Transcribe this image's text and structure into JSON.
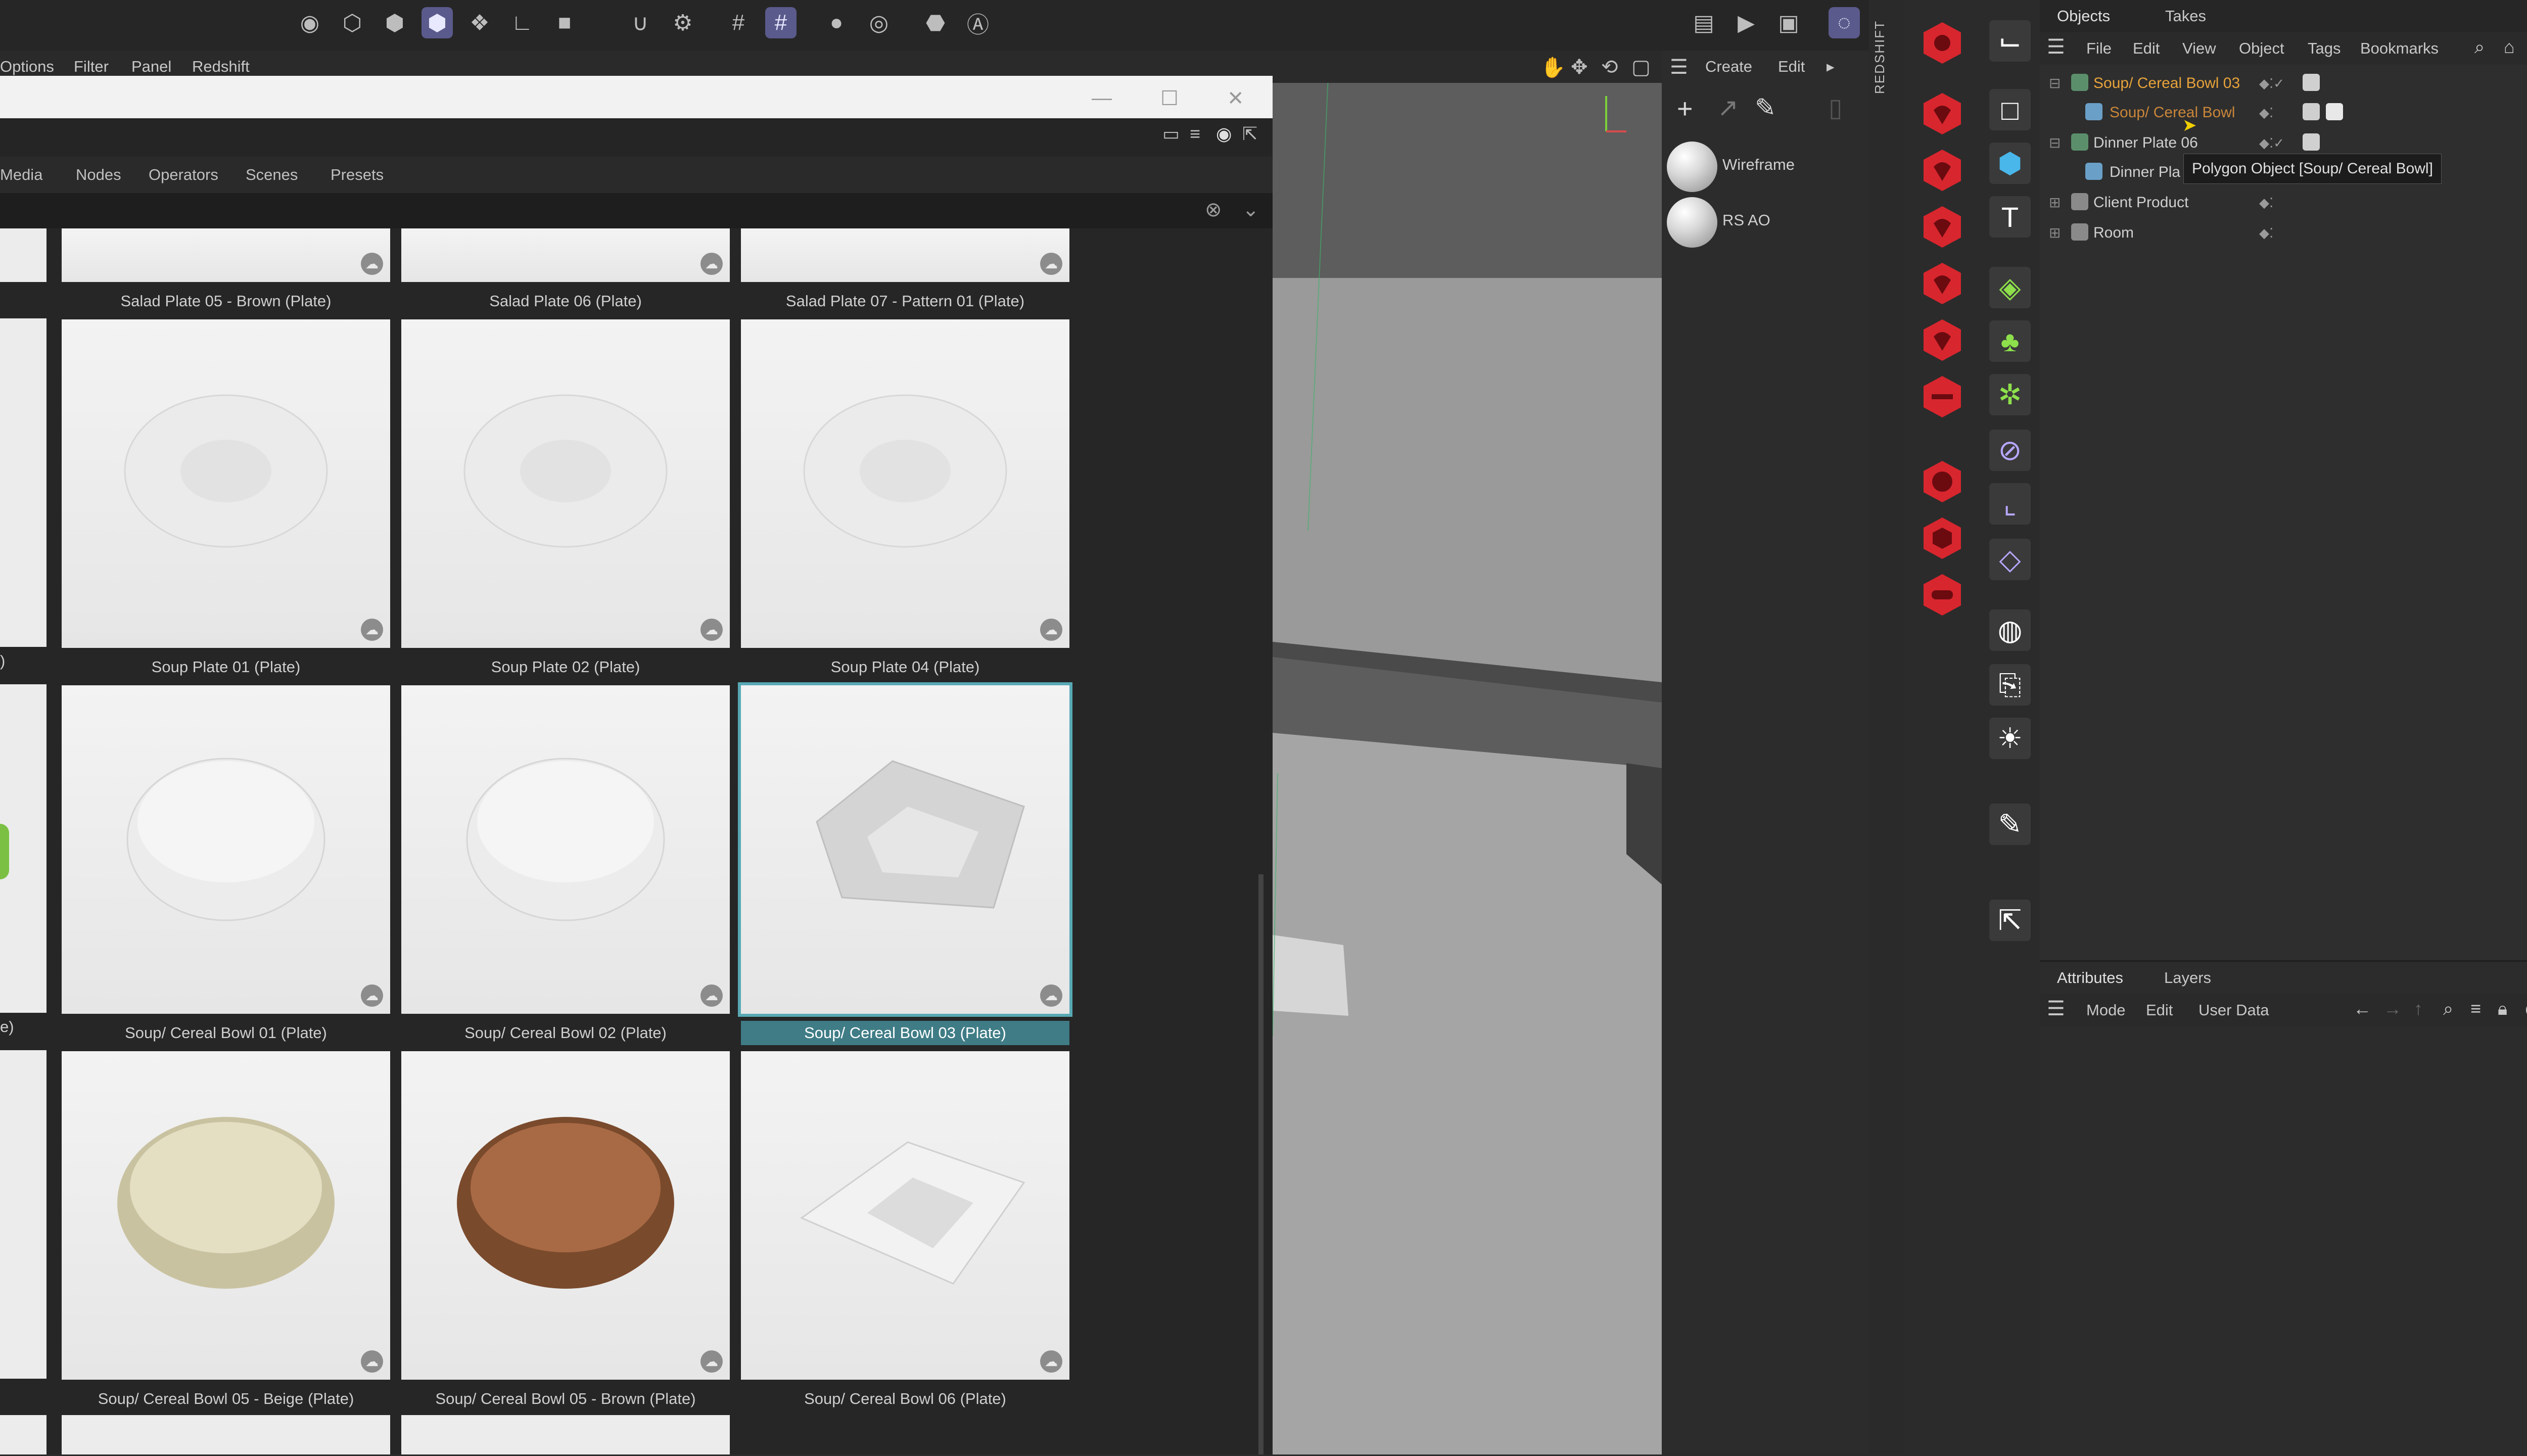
{
  "top_toolbar": {
    "icons": [
      "move-icon",
      "rotate-icon",
      "cube-icon",
      "solid-cube-icon",
      "multi-cube-icon",
      "axis-icon",
      "square-icon",
      "magnet-icon",
      "gear-icon",
      "grid-icon",
      "snap-grid-icon",
      "circle-icon",
      "target-icon",
      "hex-icon",
      "a-badge-icon"
    ]
  },
  "menubar": {
    "items": [
      "Options",
      "Filter",
      "Panel",
      "Redshift"
    ]
  },
  "browser": {
    "tabs": [
      "Media",
      "Nodes",
      "Operators",
      "Scenes",
      "Presets"
    ],
    "cells": [
      {
        "caption": "Salad Plate 05 - Brown (Plate)",
        "shape": "plate"
      },
      {
        "caption": "Salad Plate 06 (Plate)",
        "shape": "plate"
      },
      {
        "caption": "Salad Plate 07 - Pattern 01 (Plate)",
        "shape": "plate"
      },
      {
        "caption": "Soup Plate 01 (Plate)",
        "shape": "soup"
      },
      {
        "caption": "Soup Plate 02 (Plate)",
        "shape": "soup"
      },
      {
        "caption": "Soup Plate 04 (Plate)",
        "shape": "soup"
      },
      {
        "caption": "Soup/ Cereal Bowl 01 (Plate)",
        "shape": "bowl"
      },
      {
        "caption": "Soup/ Cereal Bowl 02 (Plate)",
        "shape": "bowl"
      },
      {
        "caption": "Soup/ Cereal Bowl 03 (Plate)",
        "shape": "square",
        "selected": true
      },
      {
        "caption": "Soup/ Cereal Bowl 05 - Beige (Plate)",
        "shape": "beige"
      },
      {
        "caption": "Soup/ Cereal Bowl 05 - Brown (Plate)",
        "shape": "brown"
      },
      {
        "caption": "Soup/ Cereal Bowl 06 (Plate)",
        "shape": "squaredeep"
      }
    ],
    "left_partial_captions": [
      ")",
      "e)",
      "e)"
    ]
  },
  "viewport_header": {
    "create": "Create",
    "edit": "Edit"
  },
  "materials": [
    {
      "label": "Wireframe"
    },
    {
      "label": "RS AO"
    }
  ],
  "redshift_label": "REDSHIFT",
  "object_manager": {
    "tabs": [
      "Objects",
      "Takes"
    ],
    "menu": [
      "File",
      "Edit",
      "View",
      "Object",
      "Tags",
      "Bookmarks"
    ],
    "rows": [
      {
        "name": "Soup/ Cereal Bowl 03",
        "color": "#e8a33a"
      },
      {
        "name": "Soup/ Cereal Bowl",
        "color": "#c9863a"
      },
      {
        "name": "Dinner Plate 06",
        "color": "#d0d0d0"
      },
      {
        "name": "Dinner Pla",
        "color": "#d0d0d0"
      },
      {
        "name": "Client Product",
        "color": "#d0d0d0"
      },
      {
        "name": "Room",
        "color": "#d0d0d0"
      }
    ],
    "tooltip": "Polygon Object [Soup/ Cereal Bowl]"
  },
  "attributes": {
    "tabs": [
      "Attributes",
      "Layers"
    ],
    "menu": [
      "Mode",
      "Edit",
      "User Data"
    ]
  },
  "colors": {
    "accent": "#58a9b4",
    "selected_caption": "#3f7c86",
    "redshift_red": "#d8262e",
    "active_toggle": "#5a5a8c"
  }
}
